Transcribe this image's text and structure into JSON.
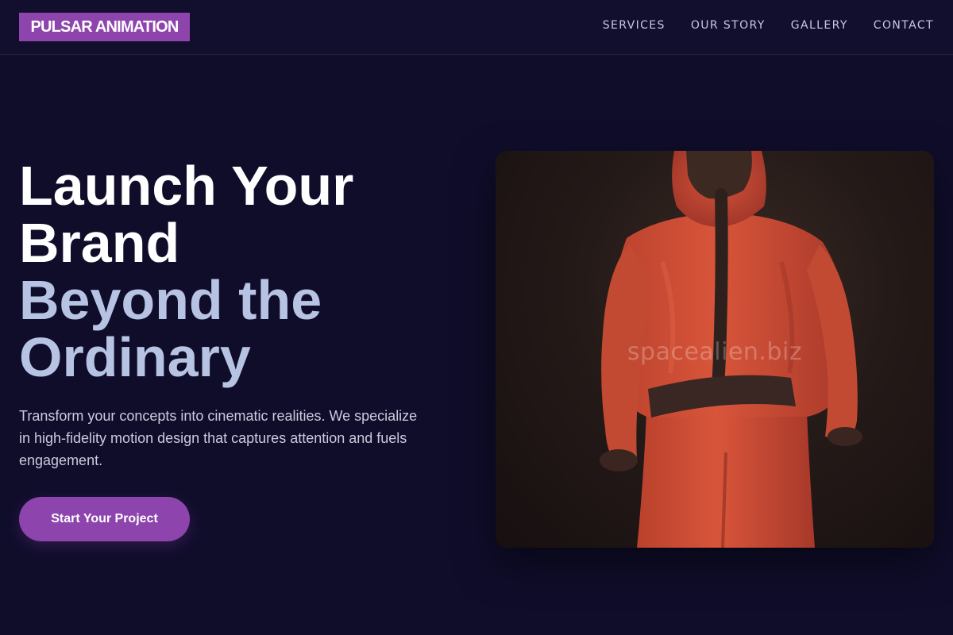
{
  "brand": {
    "logo_text": "PULSAR ANIMATION",
    "accent": "#8e44ad"
  },
  "nav": {
    "items": [
      {
        "label": "SERVICES"
      },
      {
        "label": "OUR STORY"
      },
      {
        "label": "GALLERY"
      },
      {
        "label": "CONTACT"
      }
    ]
  },
  "hero": {
    "title_line1": "Launch Your Brand",
    "title_line2": "Beyond the Ordinary",
    "description": "Transform your concepts into cinematic realities. We specialize in high-fidelity motion design that captures attention and fuels engagement.",
    "cta_label": "Start Your Project",
    "image": {
      "subject": "red-hooded-character-back-view",
      "watermark": "spacealien.biz"
    }
  },
  "colors": {
    "background": "#100d2b",
    "title_primary": "#ffffff",
    "title_secondary": "#b7c3e3",
    "text_muted": "#c9cbdd"
  }
}
